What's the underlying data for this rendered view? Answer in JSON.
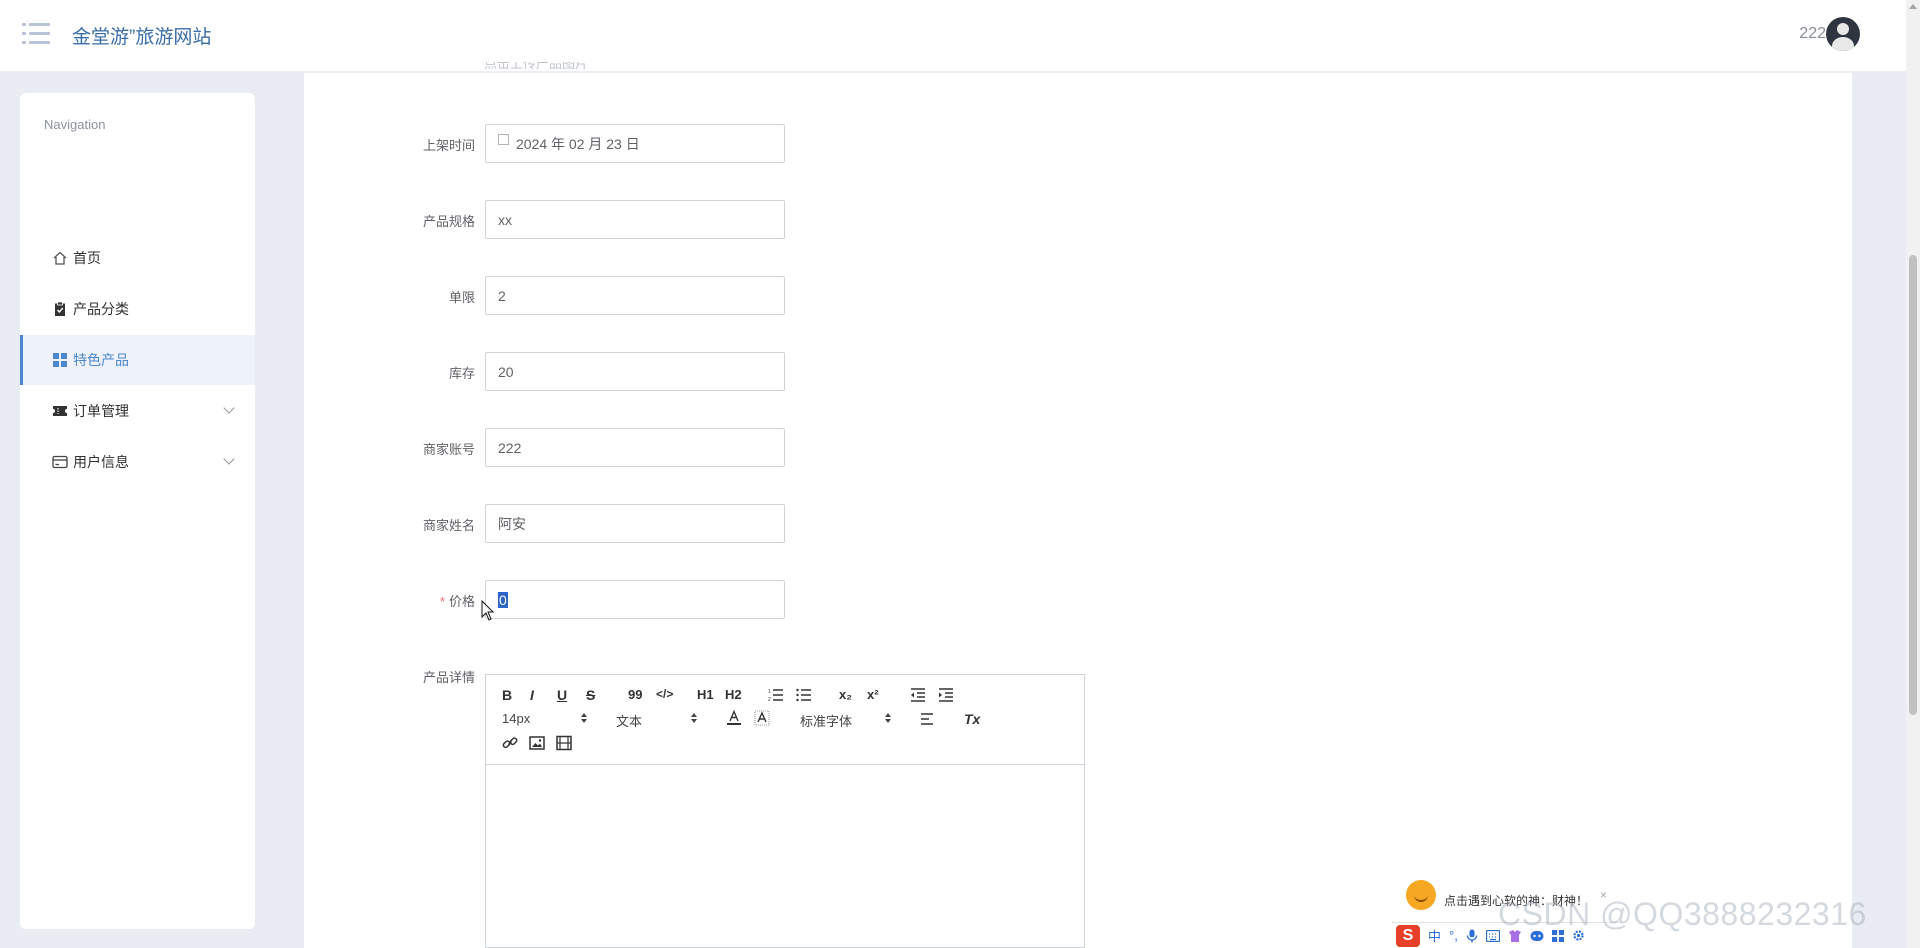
{
  "header": {
    "title": "金堂游”旅游网站",
    "user_name": "222"
  },
  "sidebar": {
    "heading": "Navigation",
    "items": [
      {
        "label": "首页",
        "icon": "home-icon"
      },
      {
        "label": "产品分类",
        "icon": "clipboard-icon"
      },
      {
        "label": "特色产品",
        "icon": "grid-icon",
        "active": true
      },
      {
        "label": "订单管理",
        "icon": "ticket-icon",
        "expandable": true
      },
      {
        "label": "用户信息",
        "icon": "card-icon",
        "expandable": true
      }
    ]
  },
  "form": {
    "cut_text": "点击上传产品图片",
    "fields": [
      {
        "label": "上架时间",
        "value": "2024 年 02 月 23 日",
        "type": "date"
      },
      {
        "label": "产品规格",
        "value": "xx"
      },
      {
        "label": "单限",
        "value": "2"
      },
      {
        "label": "库存",
        "value": "20"
      },
      {
        "label": "商家账号",
        "value": "222"
      },
      {
        "label": "商家姓名",
        "value": "阿安"
      },
      {
        "label": "价格",
        "value": "0",
        "required": true,
        "required_mark": "*"
      }
    ],
    "detail_label": "产品详情"
  },
  "editor": {
    "toolbar": {
      "bold": "B",
      "italic": "I",
      "underline": "U",
      "strike": "S",
      "quote": "99",
      "code": "</>",
      "h1": "H1",
      "h2": "H2",
      "sub": "x₂",
      "sup": "x²",
      "size": "14px",
      "format": "文本",
      "font": "标准字体",
      "clean": "Tx"
    }
  },
  "ime": {
    "bubble_text": "点击遇到心软的神：财神！",
    "close": "×",
    "logo": "S",
    "lang": "中",
    "punct": "°,"
  },
  "watermark": "CSDN @QQ3888232316",
  "colors": {
    "accent": "#4c86cf",
    "title": "#3b6da8",
    "required": "#f56c6c",
    "selection": "#2d64c8"
  }
}
